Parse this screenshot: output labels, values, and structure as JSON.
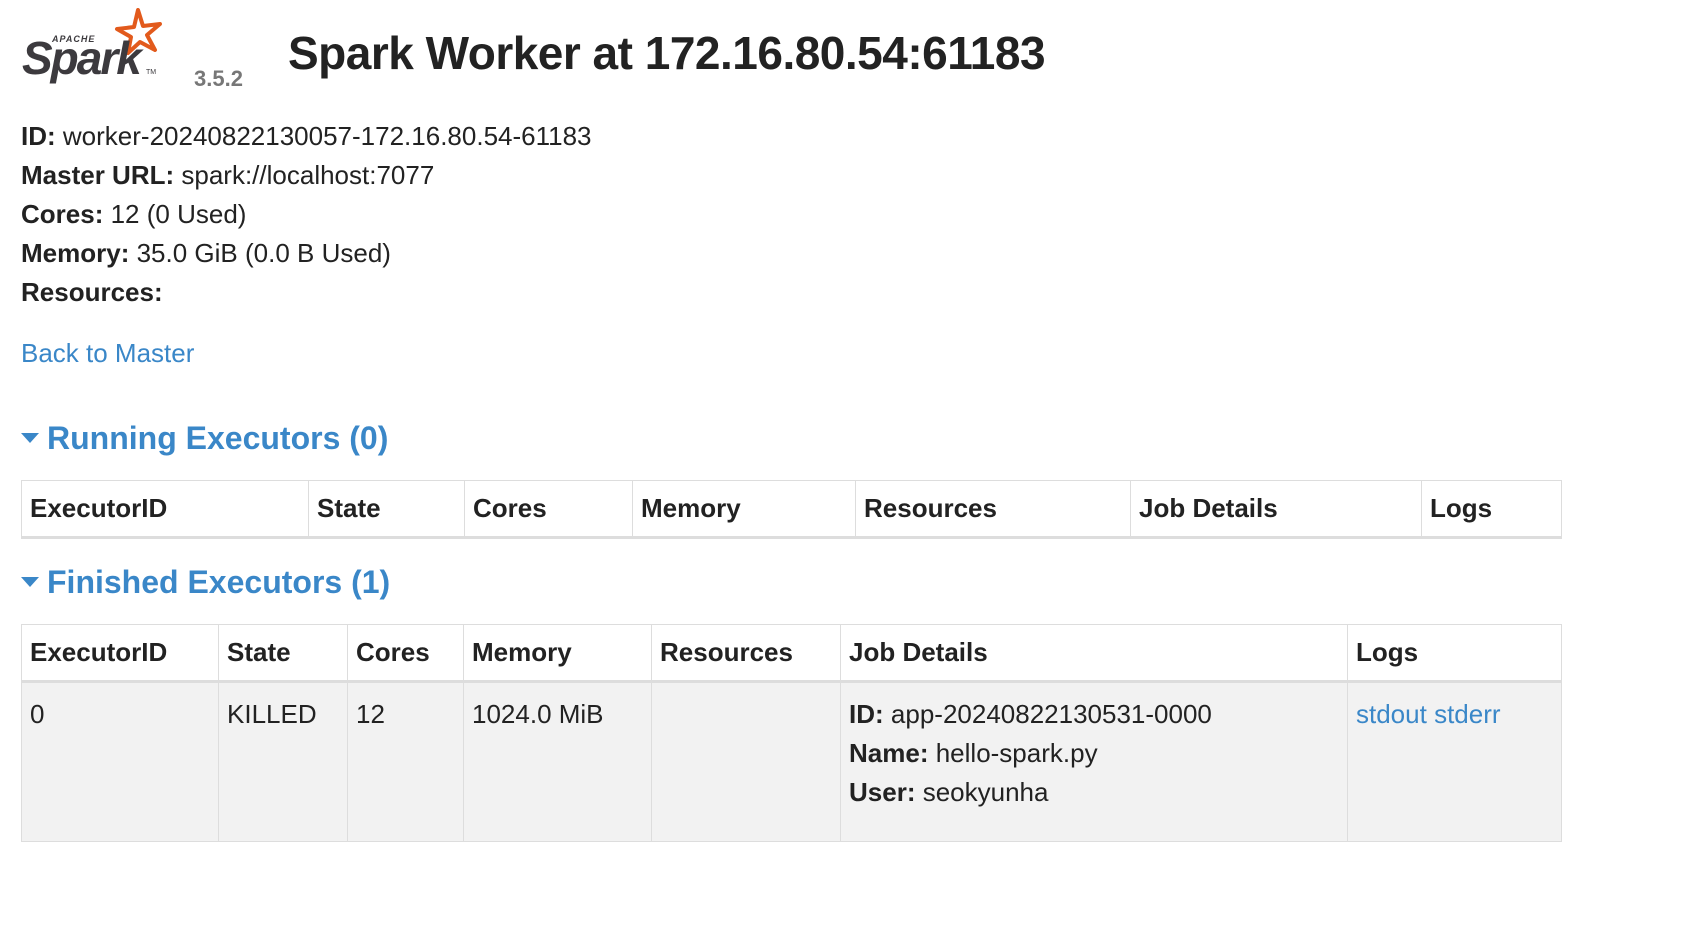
{
  "header": {
    "logo_alt": "Apache Spark",
    "version": "3.5.2",
    "title": "Spark Worker at 172.16.80.54:61183"
  },
  "info": {
    "id_label": "ID:",
    "id_value": "worker-20240822130057-172.16.80.54-61183",
    "master_label": "Master URL:",
    "master_value": "spark://localhost:7077",
    "cores_label": "Cores:",
    "cores_value": "12 (0 Used)",
    "memory_label": "Memory:",
    "memory_value": "35.0 GiB (0.0 B Used)",
    "resources_label": "Resources:",
    "resources_value": ""
  },
  "back_link": "Back to Master",
  "running": {
    "title": "Running Executors (0)",
    "columns": [
      "ExecutorID",
      "State",
      "Cores",
      "Memory",
      "Resources",
      "Job Details",
      "Logs"
    ]
  },
  "finished": {
    "title": "Finished Executors (1)",
    "columns": [
      "ExecutorID",
      "State",
      "Cores",
      "Memory",
      "Resources",
      "Job Details",
      "Logs"
    ],
    "rows": [
      {
        "executor_id": "0",
        "state": "KILLED",
        "cores": "12",
        "memory": "1024.0 MiB",
        "resources": "",
        "job_id_label": "ID:",
        "job_id": "app-20240822130531-0000",
        "job_name_label": "Name:",
        "job_name": "hello-spark.py",
        "job_user_label": "User:",
        "job_user": "seokyunha",
        "log_stdout": "stdout",
        "log_stderr": "stderr"
      }
    ]
  },
  "colors": {
    "link": "#3a87c8",
    "logo_star": "#e25a1c",
    "logo_text": "#3c3a3e"
  }
}
